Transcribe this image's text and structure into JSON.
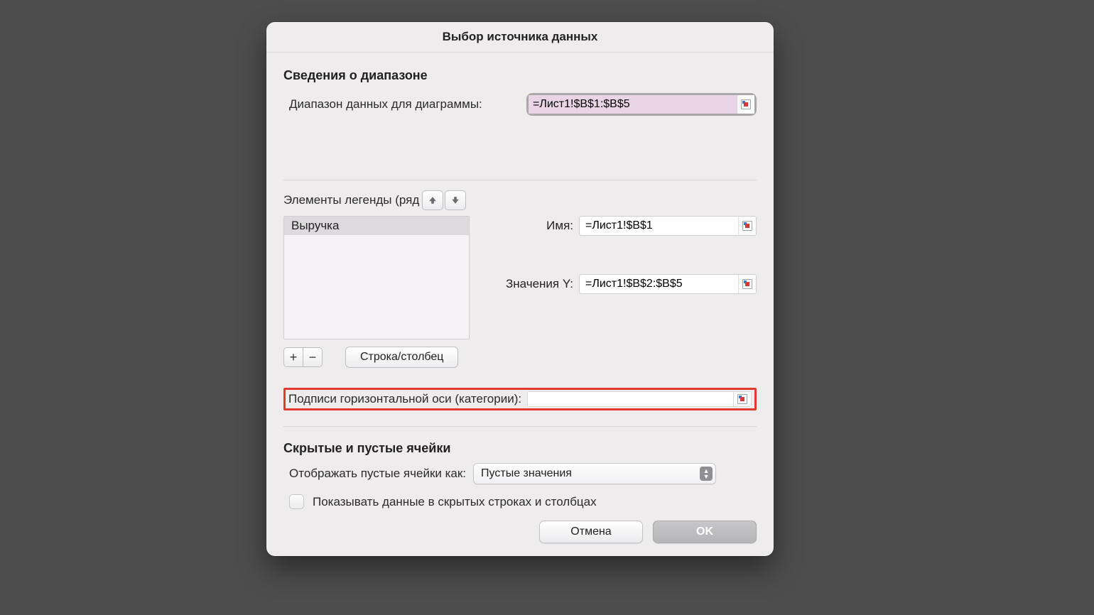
{
  "title": "Выбор источника данных",
  "range_section": {
    "header": "Сведения о диапазоне",
    "label": "Диапазон данных для диаграммы:",
    "value": "=Лист1!$B$1:$B$5"
  },
  "legend": {
    "label": "Элементы легенды (ряд",
    "items": [
      "Выручка"
    ],
    "switch_label": "Строка/столбец",
    "name_label": "Имя:",
    "name_value": "=Лист1!$B$1",
    "y_label": "Значения Y:",
    "y_value": "=Лист1!$B$2:$B$5"
  },
  "haxis": {
    "label": "Подписи горизонтальной оси (категории):",
    "value": ""
  },
  "empty_section": {
    "header": "Скрытые и пустые ячейки",
    "show_as_label": "Отображать пустые ячейки как:",
    "show_as_value": "Пустые значения",
    "hidden_checkbox_label": "Показывать данные в скрытых строках и столбцах"
  },
  "footer": {
    "cancel": "Отмена",
    "ok": "OK"
  }
}
